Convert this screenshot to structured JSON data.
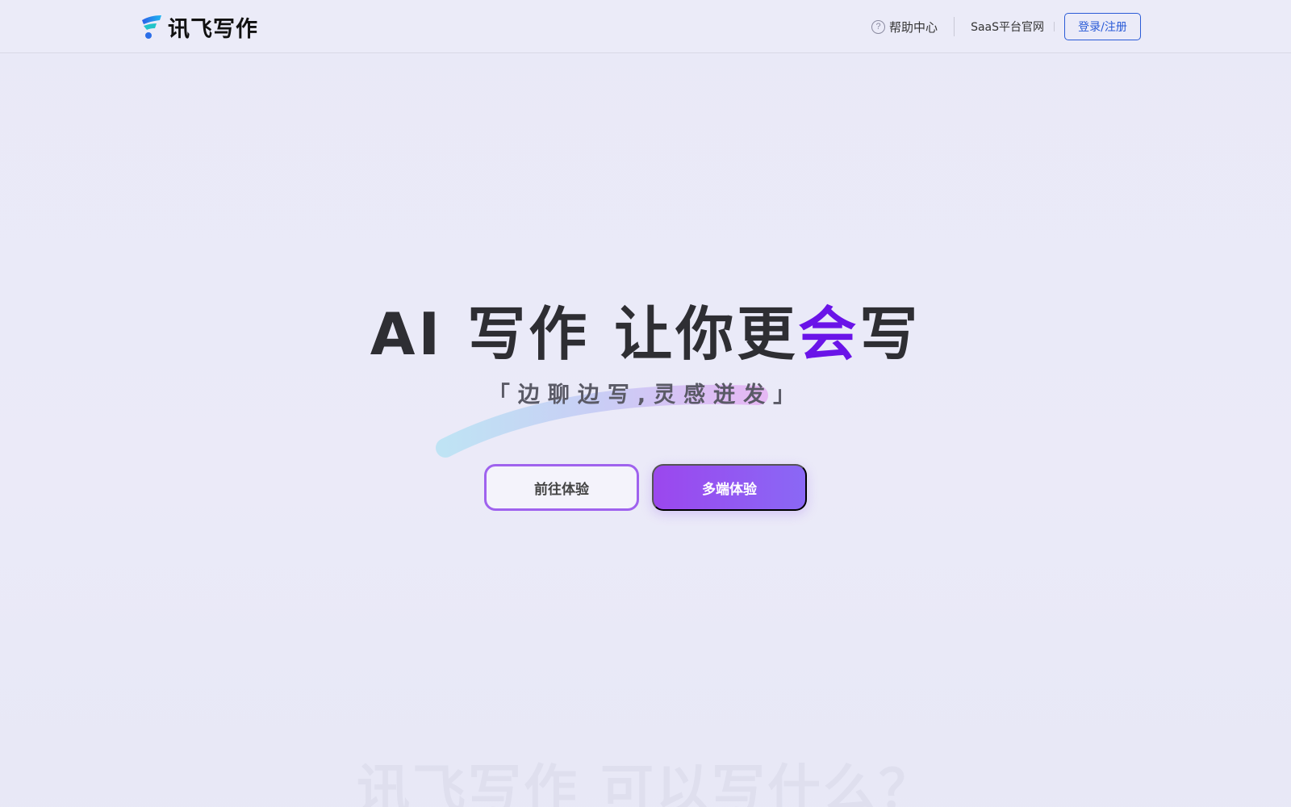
{
  "header": {
    "brand": "讯飞写作",
    "help_label": "帮助中心",
    "help_icon": "?",
    "saas_label": "SaaS平台官网",
    "login_label": "登录/注册"
  },
  "hero": {
    "title_part1": "AI",
    "title_part2": "写作",
    "title_part3": "让你更",
    "title_accent": "会",
    "title_part4": "写",
    "subtitle": "「边聊边写,灵感迸发」",
    "btn_try": "前往体验",
    "btn_multi": "多端体验"
  },
  "section": {
    "heading": "讯飞写作 可以写什么？"
  },
  "colors": {
    "accent_purple": "#6a14e8",
    "login_blue": "#2a5bd7",
    "button_gradient_start": "#9b47ee",
    "button_gradient_end": "#8a68f5"
  },
  "icons": {
    "logo": "xunfei-logo-icon",
    "help": "question-circle-icon"
  }
}
